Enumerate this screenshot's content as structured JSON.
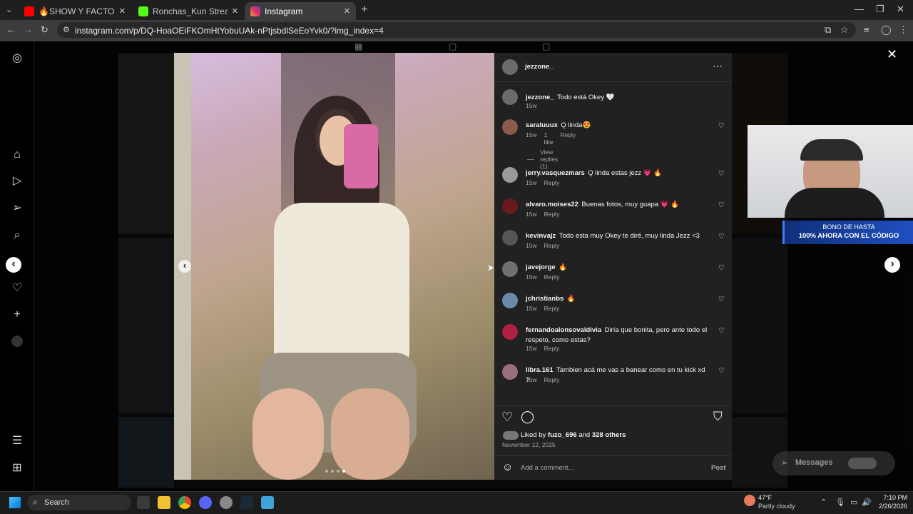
{
  "browser": {
    "tabs": [
      {
        "title": "🔥SHOW Y FACTOS🔥KINGTEI",
        "favicon_color": "#ff0000",
        "active": false
      },
      {
        "title": "Ronchas_Kun Stream - Watch L",
        "favicon_color": "#53fc18",
        "active": false
      },
      {
        "title": "Instagram",
        "favicon_color": "#e1306c",
        "active": true
      }
    ],
    "new_tab": "+",
    "url": "instagram.com/p/DQ-HoaOEiFKOmHtYobuUAk-nPtjsbdlSeEoYvk0/?img_index=4"
  },
  "post": {
    "author": "jezzone_",
    "caption": {
      "user": "jezzone_",
      "text": "Todo está Okey 🤍",
      "time": "15w"
    },
    "comments": [
      {
        "user": "saraluuux",
        "text": "Q linda😍",
        "time": "15w",
        "likes": "1 like",
        "reply": "Reply",
        "view_replies": "View replies (1)"
      },
      {
        "user": "jerry.vasquezmars",
        "text": "Q linda estas jezz 💗 🔥",
        "time": "15w",
        "reply": "Reply"
      },
      {
        "user": "alvaro.moises22",
        "text": "Buenas fotos, muy guapa 💗 🔥",
        "time": "15w",
        "reply": "Reply"
      },
      {
        "user": "kevinvajz",
        "text": "Todo esta muy Okey te diré, muy linda Jezz <3",
        "time": "15w",
        "reply": "Reply"
      },
      {
        "user": "javejorge",
        "text": "🔥",
        "time": "15w",
        "reply": "Reply"
      },
      {
        "user": "jchristianbs",
        "text": "🔥",
        "time": "15w",
        "reply": "Reply"
      },
      {
        "user": "fernandoalonsovaldivia",
        "text": "Diría que bonita, pero ante todo el respeto, como estas?",
        "time": "15w",
        "reply": "Reply"
      },
      {
        "user": "libra.161",
        "text": "Tambien acá me vas a banear como en tu kick xd ?",
        "time": "15w",
        "reply": "Reply"
      }
    ],
    "liked_by_prefix": "Liked by",
    "liked_by_user": "fuzo_696",
    "liked_by_and": "and",
    "liked_by_others": "328 others",
    "date": "November 12, 2025",
    "comment_placeholder": "Add a comment...",
    "post_button": "Post",
    "carousel_dots": 4,
    "carousel_active_index": 4
  },
  "stream_overlay": {
    "promo_line1": "BONO DE HASTA",
    "promo_line2": "100% AHORA CON EL CÓDIGO"
  },
  "messages_button": "Messages",
  "taskbar": {
    "search": "Search",
    "weather_temp": "47°F",
    "weather_desc": "Partly cloudy",
    "time": "7:10 PM",
    "date": "2/26/2026"
  }
}
